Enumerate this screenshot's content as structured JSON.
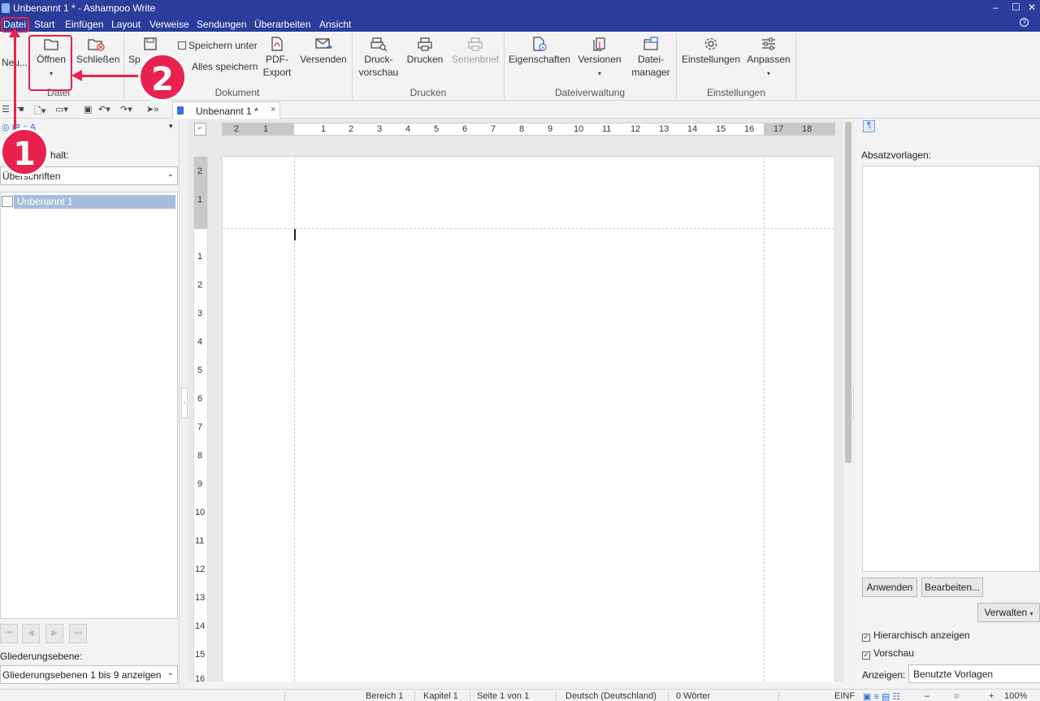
{
  "window": {
    "title": "Unbenannt 1 * - Ashampoo Write"
  },
  "menu": [
    "Datei",
    "Start",
    "Einfügen",
    "Layout",
    "Verweise",
    "Sendungen",
    "Überarbeiten",
    "Ansicht"
  ],
  "ribbon": {
    "datei_group": {
      "label": "Datei",
      "neu": "Neu...",
      "oeffnen": "Öffnen",
      "schliessen": "Schließen"
    },
    "dokument_group": {
      "label": "Dokument",
      "speichern": "Sp",
      "speichern_unter": "Speichern unter",
      "alles_speichern": "Alles speichern",
      "pdf_export": [
        "PDF-",
        "Export"
      ],
      "versenden": "Versenden"
    },
    "drucken_group": {
      "label": "Drucken",
      "druckvorschau": [
        "Druck-",
        "vorschau"
      ],
      "drucken": "Drucken",
      "serienbrief": "Serienbrief"
    },
    "dateiverwaltung_group": {
      "label": "Dateiverwaltung",
      "eigenschaften": "Eigenschaften",
      "versionen": "Versionen",
      "dateimanager": [
        "Datei-",
        "manager"
      ]
    },
    "einstellungen_group": {
      "label": "Einstellungen",
      "einstellungen": "Einstellungen",
      "anpassen": "Anpassen"
    }
  },
  "tab": {
    "label": "Unbenannt 1 *",
    "close": "×"
  },
  "left_pane": {
    "inhalt_label": "halt:",
    "inhalt_select": "Überschriften",
    "tree_item": "Unbenannt 1",
    "gliederung_label": "Gliederungsebene:",
    "gliederung_select": "Gliederungsebenen 1 bis 9 anzeigen"
  },
  "ruler": {
    "h_ticks": [
      "2",
      "1",
      "1",
      "2",
      "3",
      "4",
      "5",
      "6",
      "7",
      "8",
      "9",
      "10",
      "11",
      "12",
      "13",
      "14",
      "15",
      "16",
      "17",
      "18"
    ],
    "v_ticks": [
      "2",
      "1",
      "1",
      "2",
      "3",
      "4",
      "5",
      "6",
      "7",
      "8",
      "9",
      "10",
      "11",
      "12",
      "13",
      "14",
      "15",
      "16"
    ]
  },
  "right_pane": {
    "absatzvorlagen_label": "Absatzvorlagen:",
    "anwenden": "Anwenden",
    "bearbeiten": "Bearbeiten...",
    "verwalten": "Verwalten",
    "hierarchisch": "Hierarchisch anzeigen",
    "vorschau": "Vorschau",
    "anzeigen_label": "Anzeigen:",
    "anzeigen_select": "Benutzte Vorlagen"
  },
  "status": {
    "bereich": "Bereich 1",
    "kapitel": "Kapitel 1",
    "seite": "Seite 1 von 1",
    "sprache": "Deutsch (Deutschland)",
    "woerter": "0 Wörter",
    "modus": "EINF",
    "zoom": "100%"
  },
  "annotations": {
    "step1": "1",
    "step2": "2"
  },
  "colors": {
    "titlebar": "#2b3d9a",
    "annotation": "#e8214e"
  }
}
